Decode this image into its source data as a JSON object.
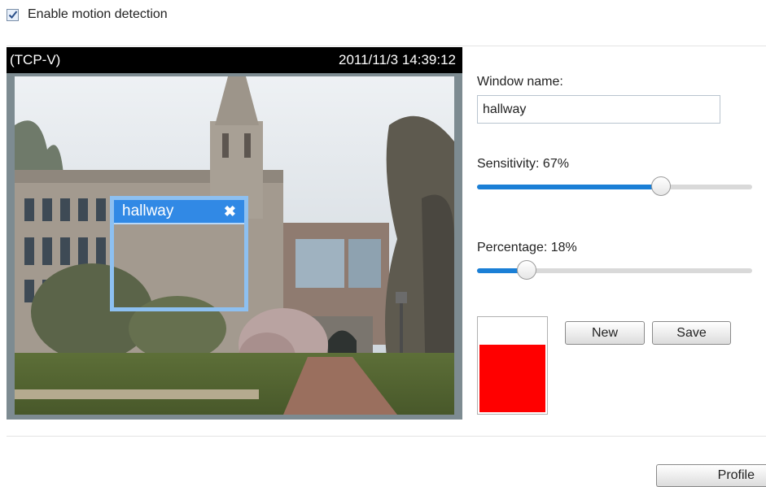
{
  "motion": {
    "enable_label": "Enable motion detection",
    "enabled": true
  },
  "video": {
    "stream_label": "(TCP-V)",
    "timestamp": "2011/11/3 14:39:12"
  },
  "detection_window": {
    "name": "hallway",
    "close_icon": "close-x-icon"
  },
  "form": {
    "window_name_label": "Window name:",
    "window_name_value": "hallway",
    "sensitivity_label": "Sensitivity: 67%",
    "sensitivity_value": 0.67,
    "percentage_label": "Percentage: 18%",
    "percentage_value": 0.18,
    "activity_level": 0.72,
    "colors": {
      "accent": "#1a7fd6",
      "alert": "#ff0000",
      "window": "#3189e5"
    }
  },
  "buttons": {
    "new_label": "New",
    "save_label": "Save",
    "profile_label": "Profile"
  }
}
